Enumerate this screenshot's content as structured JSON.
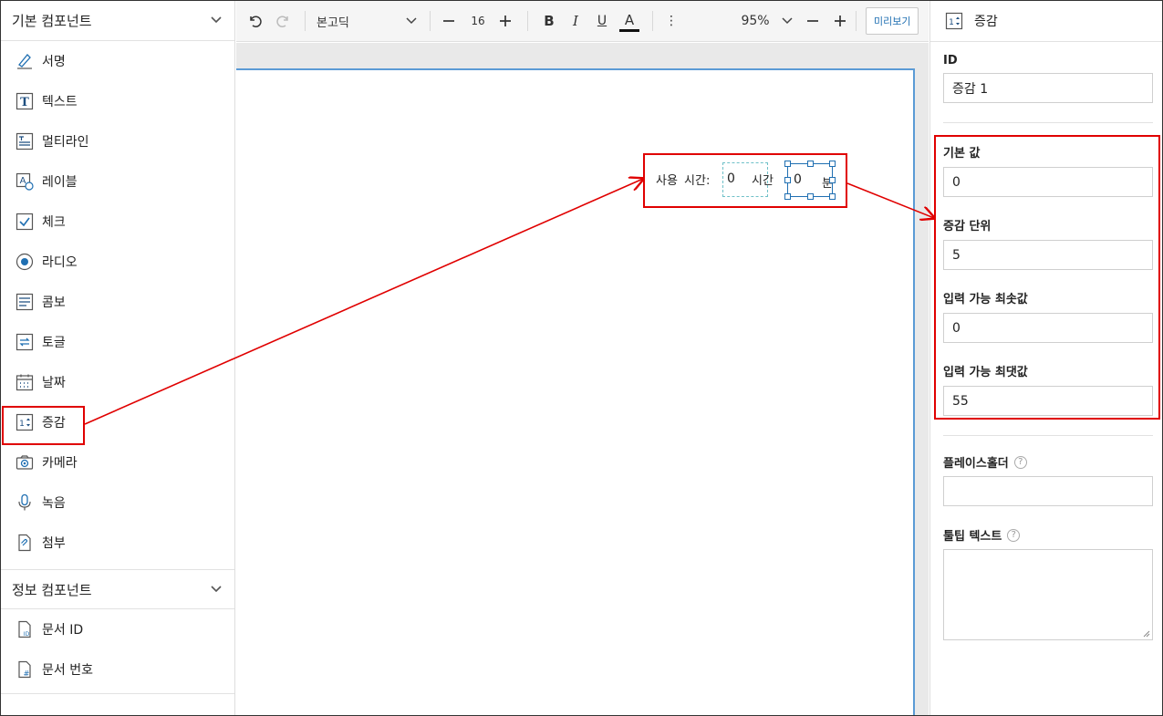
{
  "left": {
    "basic_title": "기본 컴포넌트",
    "basic_items": [
      {
        "label": "서명",
        "icon": "pen-icon"
      },
      {
        "label": "텍스트",
        "icon": "text-t-icon"
      },
      {
        "label": "멀티라인",
        "icon": "multiline-icon"
      },
      {
        "label": "레이블",
        "icon": "label-icon"
      },
      {
        "label": "체크",
        "icon": "check-icon"
      },
      {
        "label": "라디오",
        "icon": "radio-icon"
      },
      {
        "label": "콤보",
        "icon": "combo-icon"
      },
      {
        "label": "토글",
        "icon": "toggle-icon"
      },
      {
        "label": "날짜",
        "icon": "calendar-icon"
      },
      {
        "label": "증감",
        "icon": "stepper-icon"
      },
      {
        "label": "카메라",
        "icon": "camera-icon"
      },
      {
        "label": "녹음",
        "icon": "mic-icon"
      },
      {
        "label": "첨부",
        "icon": "attach-icon"
      }
    ],
    "info_title": "정보 컴포넌트",
    "info_items": [
      {
        "label": "문서 ID",
        "icon": "doc-id-icon"
      },
      {
        "label": "문서 번호",
        "icon": "doc-number-icon"
      }
    ]
  },
  "toolbar": {
    "font": "본고딕",
    "font_size": "16",
    "bold": "B",
    "italic": "I",
    "underline": "U",
    "color": "A",
    "more": "⋮",
    "zoom": "95%",
    "preview": "미리보기"
  },
  "canvas": {
    "usage_label": "사용 시간:",
    "hour_value": "0",
    "hour_unit": "시간",
    "minute_value": "0",
    "minute_unit": "분"
  },
  "right": {
    "header": "증감",
    "id_label": "ID",
    "id_value": "증감 1",
    "default_label": "기본 값",
    "default_value": "0",
    "step_label": "증감 단위",
    "step_value": "5",
    "min_label": "입력 가능 최솟값",
    "min_value": "0",
    "max_label": "입력 가능 최댓값",
    "max_value": "55",
    "placeholder_label": "플레이스홀더",
    "placeholder_value": "",
    "tooltip_label": "툴팁 텍스트",
    "tooltip_value": "",
    "help": "?"
  },
  "colors": {
    "accent": "#1f6fb2",
    "annotation": "#e00000",
    "selection": "#5b9bd5"
  }
}
